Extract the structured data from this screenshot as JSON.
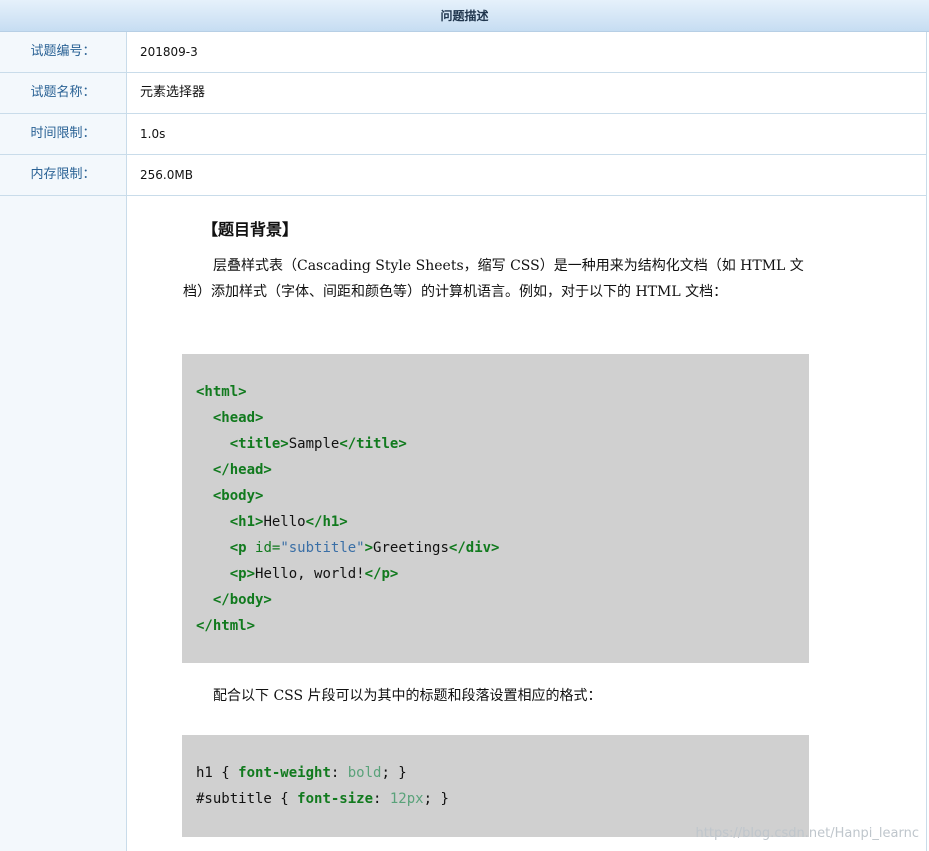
{
  "header": {
    "title": "问题描述"
  },
  "rows": [
    {
      "label": "试题编号：",
      "value": "201809-3"
    },
    {
      "label": "试题名称：",
      "value": "元素选择器"
    },
    {
      "label": "时间限制：",
      "value": "1.0s"
    },
    {
      "label": "内存限制：",
      "value": "256.0MB"
    }
  ],
  "content": {
    "section_title": "【题目背景】",
    "paragraph1": "层叠样式表（Cascading Style Sheets，缩写 CSS）是一种用来为结构化文档（如 HTML 文档）添加样式（字体、间距和颜色等）的计算机语言。例如，对于以下的 HTML 文档：",
    "html_code": {
      "l1_open": "<html>",
      "l2_open": "<head>",
      "l3_open": "<title>",
      "l3_text": "Sample",
      "l3_close": "</title>",
      "l4_close": "</head>",
      "l5_open": "<body>",
      "l6_open": "<h1>",
      "l6_text": "Hello",
      "l6_close": "</h1>",
      "l7_open_start": "<p",
      "l7_attr": "id=",
      "l7_value": "\"subtitle\"",
      "l7_open_end": ">",
      "l7_text": "Greetings",
      "l7_close": "</div>",
      "l8_open": "<p>",
      "l8_text": "Hello, world!",
      "l8_close": "</p>",
      "l9_close": "</body>",
      "l10_close": "</html>"
    },
    "paragraph2": "配合以下 CSS 片段可以为其中的标题和段落设置相应的格式：",
    "css_code": {
      "l1_selector": "h1 { ",
      "l1_prop": "font-weight",
      "l1_colon": ": ",
      "l1_value": "bold",
      "l1_end": "; }",
      "l2_selector": "#subtitle { ",
      "l2_prop": "font-size",
      "l2_colon": ": ",
      "l2_value": "12px",
      "l2_end": "; }"
    }
  },
  "watermark": "https://blog.csdn.net/Hanpi_learnc",
  "colors": {
    "header_bg": "#c6ddf2",
    "label_text": "#2a6295",
    "border": "#c9dcea",
    "code_bg": "#d0d0d0",
    "code_tag": "#117a1e",
    "code_string": "#3a6fa6"
  }
}
